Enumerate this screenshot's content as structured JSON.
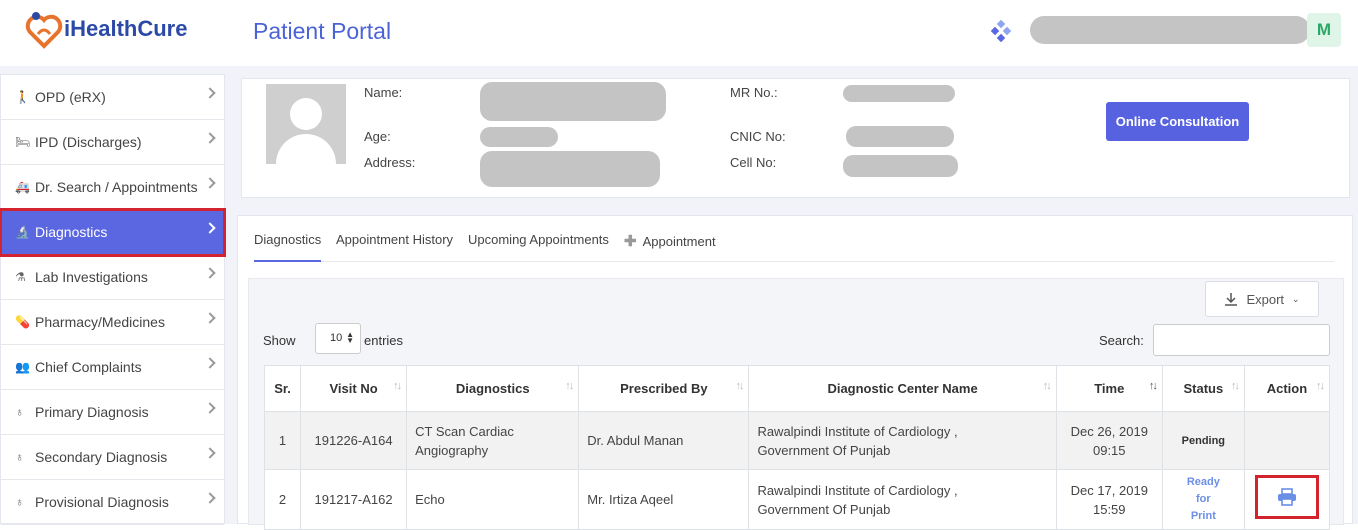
{
  "header": {
    "logo_text": "iHealthCure",
    "portal_title": "Patient Portal",
    "avatar_letter": "M"
  },
  "sidebar": {
    "items": [
      {
        "label": "OPD (eRX)",
        "icon": "walk-icon"
      },
      {
        "label": "IPD (Discharges)",
        "icon": "bed-icon"
      },
      {
        "label": "Dr. Search / Appointments",
        "icon": "ambulance-icon"
      },
      {
        "label": "Diagnostics",
        "icon": "microscope-icon",
        "active": true
      },
      {
        "label": "Lab Investigations",
        "icon": "flask-icon"
      },
      {
        "label": "Pharmacy/Medicines",
        "icon": "pill-icon"
      },
      {
        "label": "Chief Complaints",
        "icon": "people-icon"
      },
      {
        "label": "Primary Diagnosis",
        "icon": "stethoscope-icon"
      },
      {
        "label": "Secondary Diagnosis",
        "icon": "stethoscope-icon"
      },
      {
        "label": "Provisional Diagnosis",
        "icon": "stethoscope-icon"
      }
    ]
  },
  "profile": {
    "name_label": "Name:",
    "age_label": "Age:",
    "address_label": "Address:",
    "mr_label": "MR No.:",
    "cnic_label": "CNIC No:",
    "cell_label": "Cell No:",
    "online_consultation": "Online Consultation"
  },
  "tabs": {
    "diagnostics": "Diagnostics",
    "appointment_history": "Appointment History",
    "upcoming": "Upcoming Appointments",
    "appointment": "Appointment"
  },
  "table_controls": {
    "export": "Export",
    "show": "Show",
    "entries_value": "10",
    "entries": "entries",
    "search": "Search:"
  },
  "table": {
    "headers": [
      "Sr.",
      "Visit No",
      "Diagnostics",
      "Prescribed By",
      "Diagnostic Center Name",
      "Time",
      "Status",
      "Action"
    ],
    "rows": [
      {
        "sr": "1",
        "visit": "191226-A164",
        "diag1": "CT Scan Cardiac",
        "diag2": "Angiography",
        "prescribed": "Dr. Abdul Manan",
        "center1": "Rawalpindi Institute of Cardiology ,",
        "center2": "Government Of Punjab",
        "date": "Dec 26, 2019",
        "time": "09:15",
        "status": "Pending"
      },
      {
        "sr": "2",
        "visit": "191217-A162",
        "diag1": "Echo",
        "diag2": "",
        "prescribed": "Mr. Irtiza Aqeel",
        "center1": "Rawalpindi Institute of Cardiology ,",
        "center2": "Government Of Punjab",
        "date": "Dec 17, 2019",
        "time": "15:59",
        "status1": "Ready",
        "status2": "for",
        "status3": "Print"
      }
    ]
  },
  "colors": {
    "accent": "#5b67e0",
    "highlight": "#d3232e",
    "brand": "#2b4aa8"
  }
}
